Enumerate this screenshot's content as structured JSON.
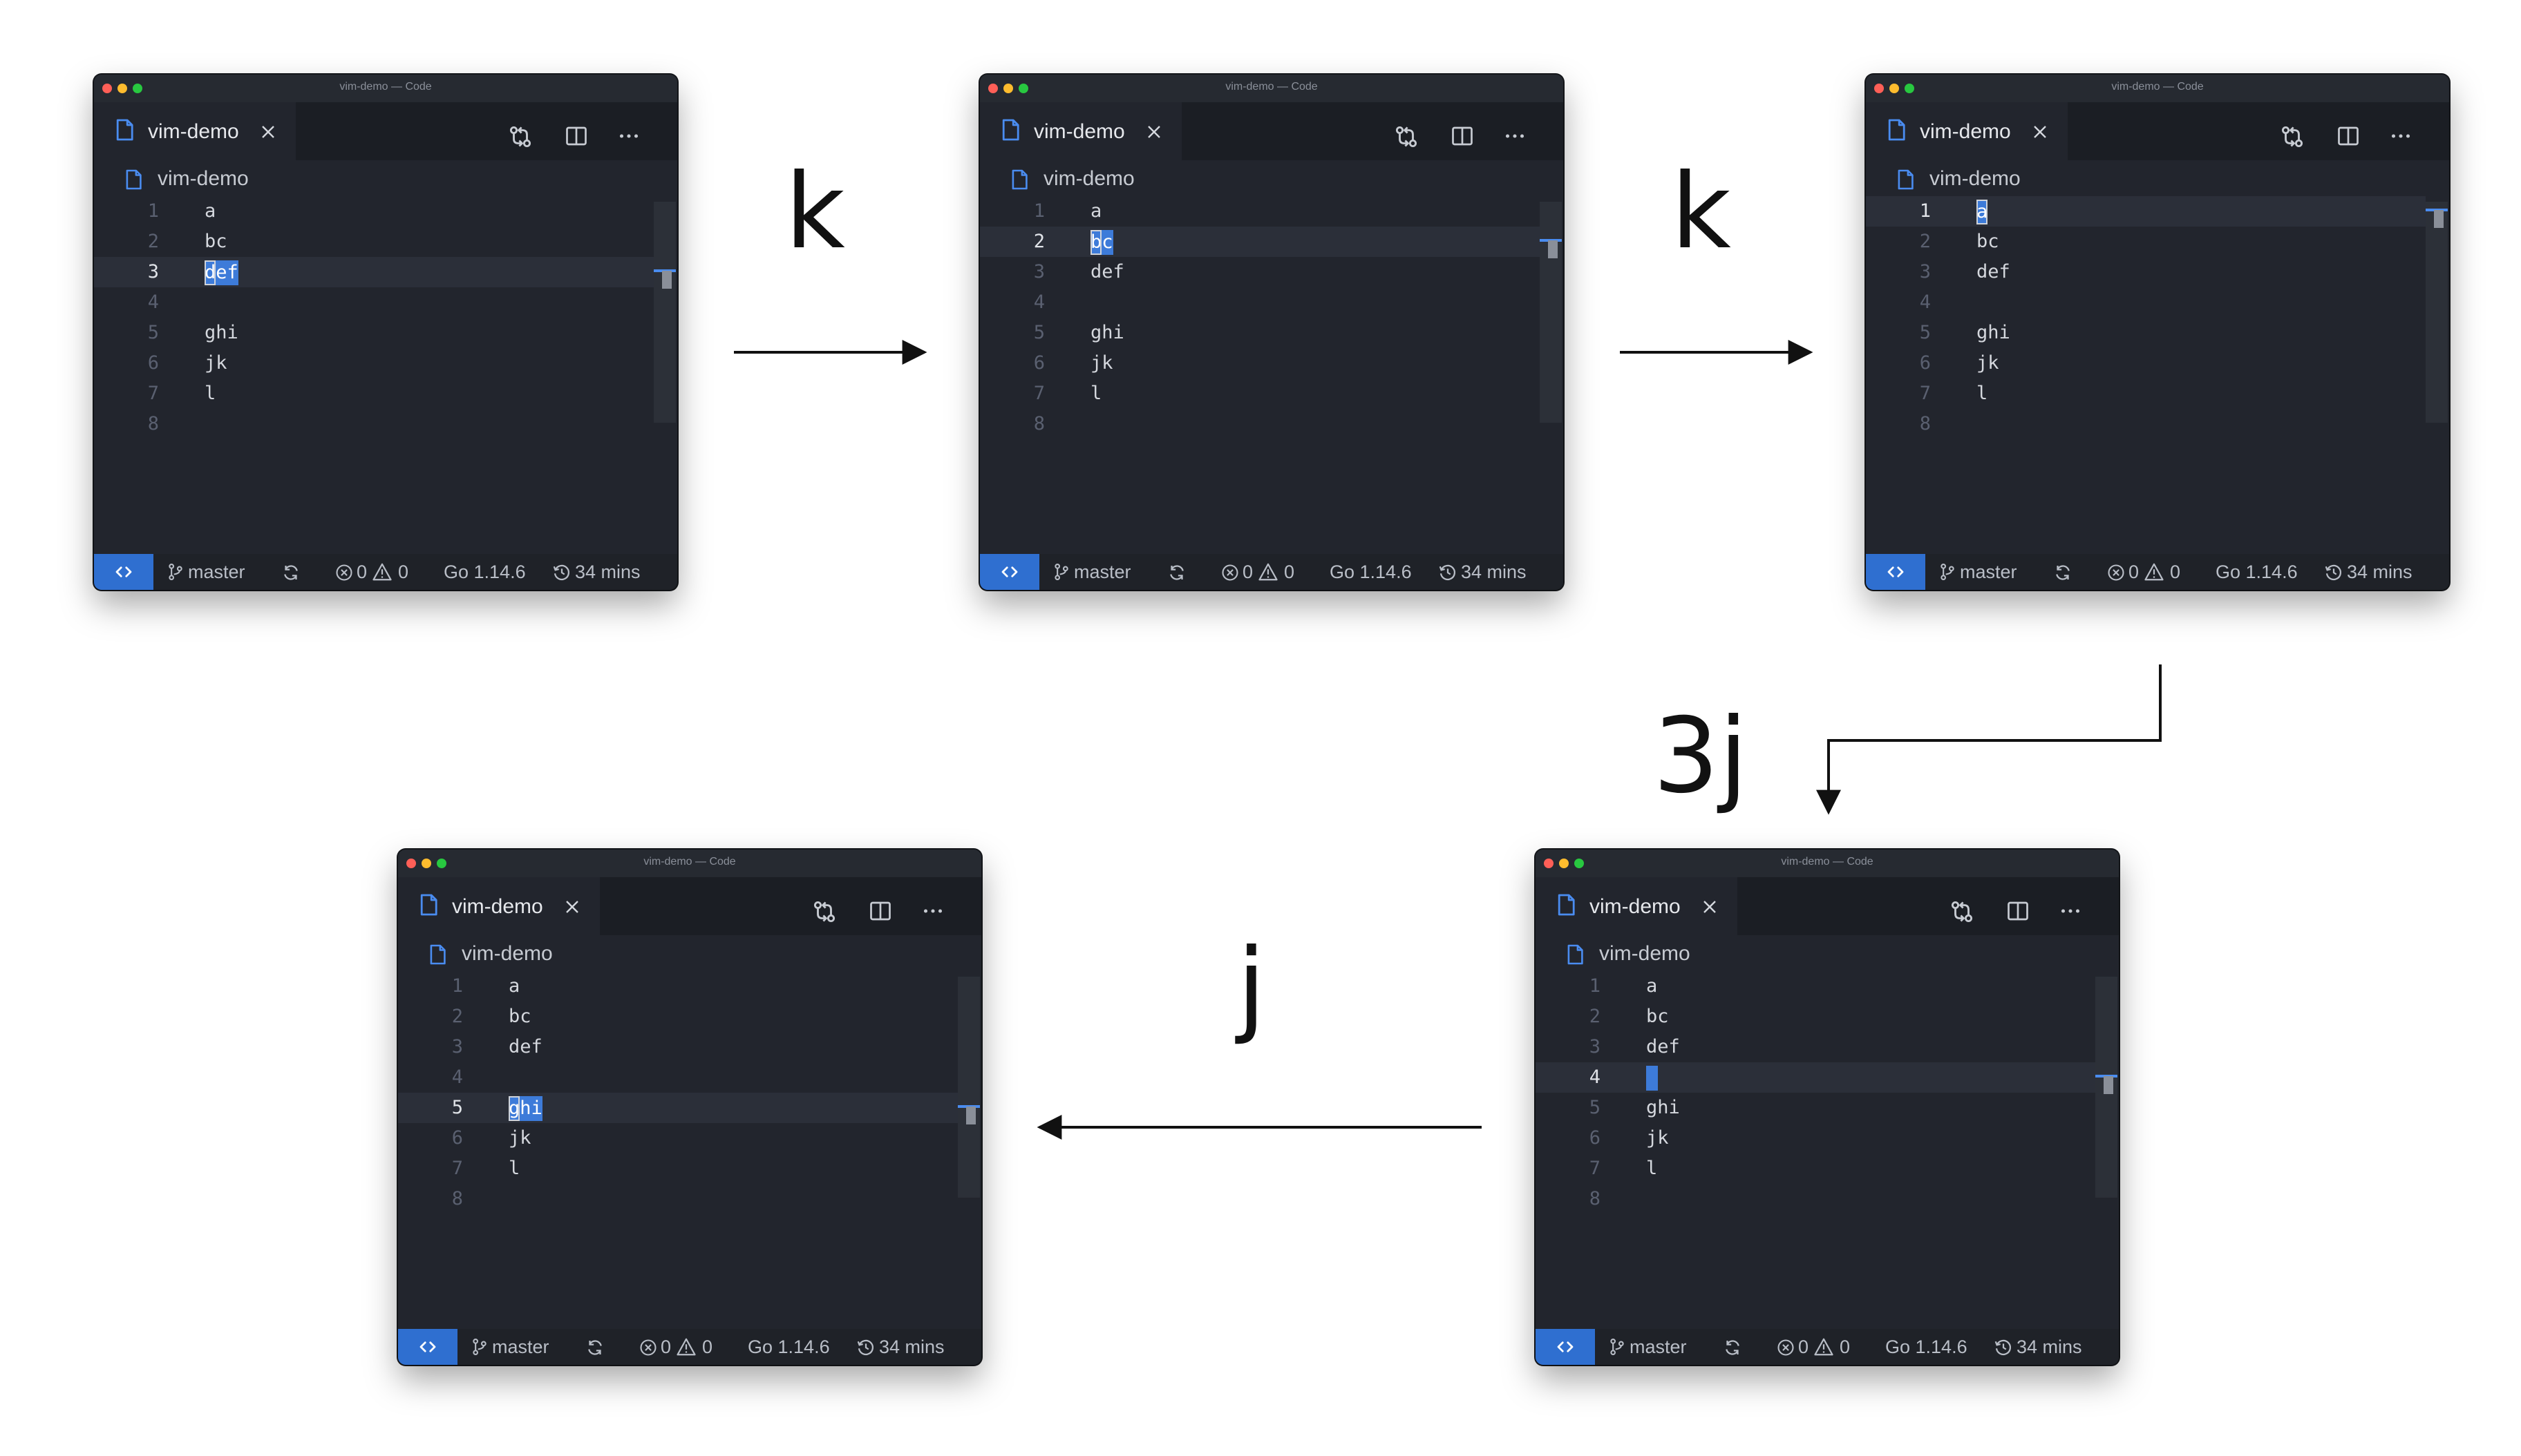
{
  "window": {
    "title": "vim-demo — Code",
    "tab_label": "vim-demo",
    "breadcrumb": "vim-demo"
  },
  "status": {
    "branch": "master",
    "errors": "0",
    "warnings": "0",
    "go_version": "Go 1.14.6",
    "time_spent": "34 mins"
  },
  "icons": {
    "file": "file-icon",
    "close": "close-icon",
    "compare": "git-compare-icon",
    "split": "split-editor-icon",
    "more": "more-actions-icon",
    "remote": "remote-icon",
    "branch": "git-branch-icon",
    "sync": "sync-icon",
    "errors": "error-icon",
    "warnings": "warning-icon",
    "history": "history-icon"
  },
  "lines": [
    {
      "number": "1",
      "text": "a"
    },
    {
      "number": "2",
      "text": "bc"
    },
    {
      "number": "3",
      "text": "def"
    },
    {
      "number": "4",
      "text": ""
    },
    {
      "number": "5",
      "text": "ghi"
    },
    {
      "number": "6",
      "text": "jk"
    },
    {
      "number": "7",
      "text": "l"
    },
    {
      "number": "8",
      "text": ""
    }
  ],
  "steps": [
    {
      "current_line": 3,
      "cursor_column": 1,
      "highlight_columns": [
        2,
        3
      ]
    },
    {
      "current_line": 2,
      "cursor_column": 1,
      "highlight_columns": [
        2
      ]
    },
    {
      "current_line": 1,
      "cursor_column": 1,
      "highlight_columns": []
    },
    {
      "current_line": 4,
      "cursor_column": 1,
      "highlight_columns": []
    },
    {
      "current_line": 5,
      "cursor_column": 1,
      "highlight_columns": [
        2,
        3
      ]
    }
  ],
  "transitions": [
    {
      "key": "k",
      "from_step": 1,
      "to_step": 2
    },
    {
      "key": "k",
      "from_step": 2,
      "to_step": 3
    },
    {
      "key": "3j",
      "from_step": 3,
      "to_step": 4
    },
    {
      "key": "j",
      "from_step": 4,
      "to_step": 5
    }
  ],
  "colors": {
    "accent": "#3d7bd9",
    "editor_background": "#22252d",
    "status_remote": "#2f6fd0"
  }
}
